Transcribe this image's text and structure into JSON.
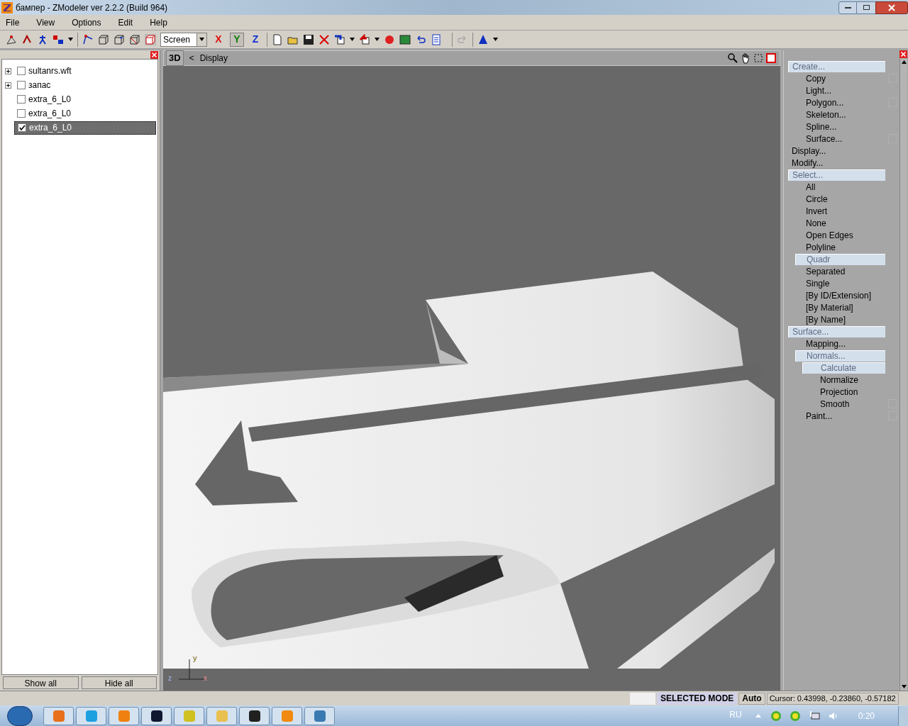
{
  "window": {
    "title": "бампер - ZModeler ver 2.2.2 (Build 964)"
  },
  "menu": [
    "File",
    "View",
    "Options",
    "Edit",
    "Help"
  ],
  "toolbar": {
    "space": "Screen",
    "axes": [
      {
        "label": "X",
        "color": "#e01010",
        "selected": false
      },
      {
        "label": "Y",
        "color": "#108010",
        "selected": true
      },
      {
        "label": "Z",
        "color": "#1030d0",
        "selected": false
      }
    ]
  },
  "tree": [
    {
      "label": "sultanrs.wft",
      "kind": "group",
      "expanded": false,
      "checked": false,
      "selected": false
    },
    {
      "label": "запас",
      "kind": "group",
      "expanded": false,
      "checked": false,
      "selected": false
    },
    {
      "label": "extra_6_L0",
      "kind": "leaf",
      "checked": false,
      "selected": false
    },
    {
      "label": "extra_6_L0",
      "kind": "leaf",
      "checked": false,
      "selected": false
    },
    {
      "label": "extra_6_L0",
      "kind": "leaf",
      "checked": true,
      "selected": true
    }
  ],
  "left_buttons": [
    "Show all",
    "Hide all"
  ],
  "viewport": {
    "mode": "3D",
    "back": "<",
    "title": "Display",
    "gizmo": [
      "y",
      "z",
      "x"
    ]
  },
  "commands": [
    {
      "label": "Create...",
      "highlighted": true,
      "children": [
        {
          "label": "Copy",
          "highlighted": false,
          "kind": "toggle",
          "checked": false
        },
        {
          "label": "Light...",
          "highlighted": false,
          "kind": "command"
        },
        {
          "label": "Polygon...",
          "highlighted": false,
          "kind": "toggle",
          "checked": false
        },
        {
          "label": "Skeleton...",
          "highlighted": false,
          "kind": "command"
        },
        {
          "label": "Spline...",
          "highlighted": false,
          "kind": "command"
        },
        {
          "label": "Surface...",
          "highlighted": false,
          "kind": "toggle",
          "checked": false
        }
      ]
    },
    {
      "label": "Display...",
      "highlighted": false
    },
    {
      "label": "Modify...",
      "highlighted": false
    },
    {
      "label": "Select...",
      "highlighted": true,
      "children": [
        {
          "label": "All",
          "highlighted": false,
          "kind": "command"
        },
        {
          "label": "Circle",
          "highlighted": false,
          "kind": "command"
        },
        {
          "label": "Invert",
          "highlighted": false,
          "kind": "command"
        },
        {
          "label": "None",
          "highlighted": false,
          "kind": "command"
        },
        {
          "label": "Open Edges",
          "highlighted": false,
          "kind": "command"
        },
        {
          "label": "Polyline",
          "highlighted": false,
          "kind": "command"
        },
        {
          "label": "Quadr",
          "highlighted": true,
          "kind": "command"
        },
        {
          "label": "Separated",
          "highlighted": false,
          "kind": "command"
        },
        {
          "label": "Single",
          "highlighted": false,
          "kind": "command"
        },
        {
          "label": "[By ID/Extension]",
          "highlighted": false,
          "kind": "command"
        },
        {
          "label": "[By Material]",
          "highlighted": false,
          "kind": "command"
        },
        {
          "label": "[By Name]",
          "highlighted": false,
          "kind": "command"
        }
      ]
    },
    {
      "label": "Surface...",
      "highlighted": true,
      "children": [
        {
          "label": "Mapping...",
          "highlighted": false,
          "kind": "command"
        },
        {
          "label": "Normals...",
          "highlighted": true,
          "kind": "command",
          "children": [
            {
              "label": "Calculate",
              "highlighted": true,
              "kind": "command"
            },
            {
              "label": "Normalize",
              "highlighted": false,
              "kind": "command"
            },
            {
              "label": "Projection",
              "highlighted": false,
              "kind": "command"
            },
            {
              "label": "Smooth",
              "highlighted": false,
              "kind": "toggle",
              "checked": false
            }
          ]
        },
        {
          "label": "Paint...",
          "highlighted": false,
          "kind": "toggle",
          "checked": false
        }
      ]
    }
  ],
  "status_bar": {
    "mode": "SELECTED MODE",
    "snap": "Auto",
    "cursor": "Cursor: 0.43998, -0.23860, -0.57182"
  },
  "taskbar": {
    "language": "RU",
    "clock": "0:20"
  }
}
